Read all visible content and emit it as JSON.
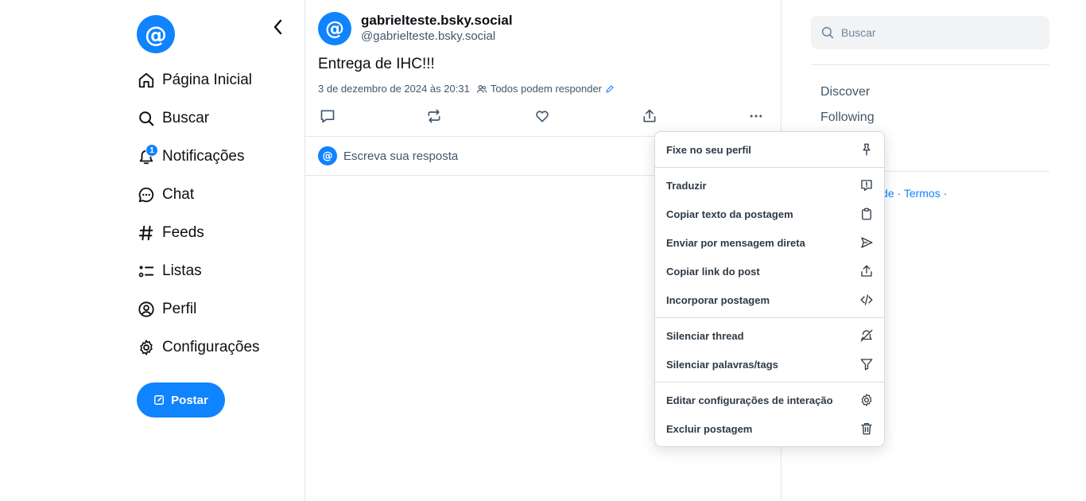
{
  "colors": {
    "accent": "#1083fe",
    "text": "#0b0f14",
    "muted": "#42576c",
    "border": "#e1e6ea"
  },
  "app": {
    "logo_glyph": "@"
  },
  "nav": {
    "items": [
      {
        "label": "Página Inicial",
        "icon": "home-icon"
      },
      {
        "label": "Buscar",
        "icon": "search-icon"
      },
      {
        "label": "Notificações",
        "icon": "bell-icon",
        "badge": "1"
      },
      {
        "label": "Chat",
        "icon": "chat-icon"
      },
      {
        "label": "Feeds",
        "icon": "hash-icon"
      },
      {
        "label": "Listas",
        "icon": "list-icon"
      },
      {
        "label": "Perfil",
        "icon": "user-icon"
      },
      {
        "label": "Configurações",
        "icon": "gear-icon"
      }
    ],
    "post_button": "Postar"
  },
  "post": {
    "avatar_glyph": "@",
    "display_name": "gabrielteste.bsky.social",
    "handle": "@gabrielteste.bsky.social",
    "text": "Entrega de IHC!!!",
    "timestamp": "3 de dezembro de 2024 às 20:31",
    "reply_setting": "Todos podem responder",
    "reply_placeholder": "Escreva sua resposta"
  },
  "right": {
    "search_placeholder": "Buscar",
    "feeds": [
      "Discover",
      "Following"
    ],
    "footer": {
      "partial": "s",
      "privacy": "Privacidade",
      "terms": "Termos",
      "sep": " · "
    }
  },
  "menu": {
    "groups": [
      [
        {
          "label": "Fixe no seu perfil",
          "icon": "pin-icon"
        }
      ],
      [
        {
          "label": "Traduzir",
          "icon": "translate-icon"
        },
        {
          "label": "Copiar texto da postagem",
          "icon": "clipboard-icon"
        },
        {
          "label": "Enviar por mensagem direta",
          "icon": "send-icon"
        },
        {
          "label": "Copiar link do post",
          "icon": "share-icon"
        },
        {
          "label": "Incorporar postagem",
          "icon": "code-icon"
        }
      ],
      [
        {
          "label": "Silenciar thread",
          "icon": "mute-bell-icon"
        },
        {
          "label": "Silenciar palavras/tags",
          "icon": "filter-icon"
        }
      ],
      [
        {
          "label": "Editar configurações de interação",
          "icon": "gear-icon"
        },
        {
          "label": "Excluir postagem",
          "icon": "trash-icon"
        }
      ]
    ]
  }
}
